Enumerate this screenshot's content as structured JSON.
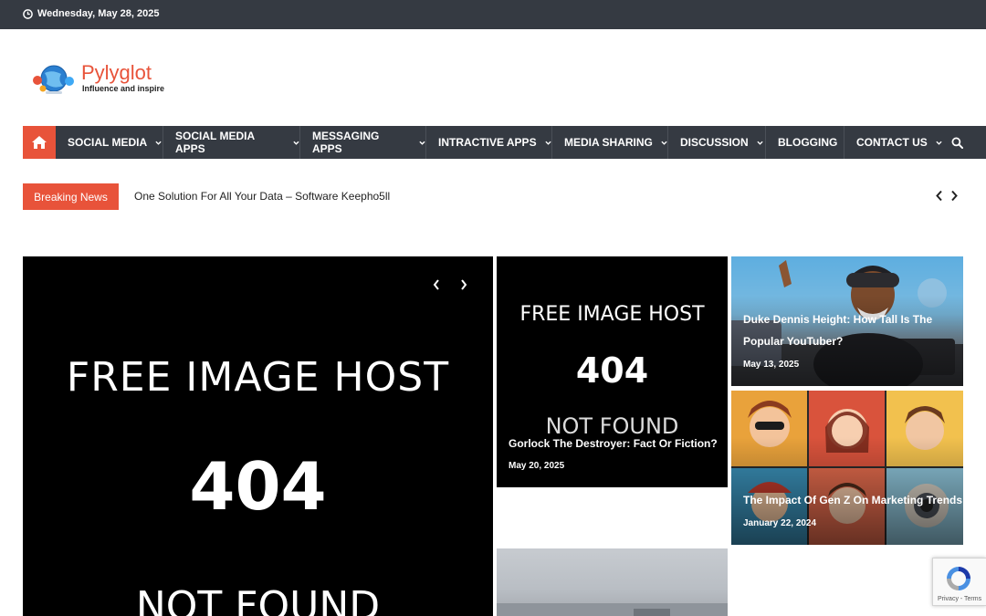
{
  "topbar": {
    "date": "Wednesday, May 28, 2025",
    "icon": "clock-icon"
  },
  "header": {
    "site_title": "Pylyglot",
    "tagline": "Influence and inspire"
  },
  "nav": {
    "home_icon": "home-icon",
    "items": [
      {
        "label": "SOCIAL MEDIA",
        "has_dropdown": true
      },
      {
        "label": "SOCIAL MEDIA APPS",
        "has_dropdown": true
      },
      {
        "label": "MESSAGING APPS",
        "has_dropdown": true
      },
      {
        "label": "INTRACTIVE APPS",
        "has_dropdown": true
      },
      {
        "label": "MEDIA SHARING",
        "has_dropdown": true
      },
      {
        "label": "DISCUSSION",
        "has_dropdown": true
      },
      {
        "label": "BLOGGING",
        "has_dropdown": false
      },
      {
        "label": "CONTACT US",
        "has_dropdown": true
      }
    ],
    "search_icon": "search-icon"
  },
  "breaking": {
    "label": "Breaking News",
    "headline": "One Solution For All Your Data – Software Keepho5ll"
  },
  "placeholder": {
    "line1": "FREE IMAGE HOST",
    "line2": "404",
    "line3": "NOT FOUND"
  },
  "cards": [
    {
      "title": "Gorlock The Destroyer: Fact Or Fiction?",
      "date": "May 20, 2025"
    },
    {
      "title_line1": "Duke Dennis Height: How Tall Is The",
      "title_line2": "Popular YouTuber?",
      "date": "May 13, 2025"
    },
    {
      "title": "The Impact Of Gen Z On Marketing Trends",
      "date": "January 22, 2024"
    }
  ],
  "recaptcha": {
    "text": "Privacy - Terms"
  },
  "colors": {
    "accent": "#e8533a",
    "dark": "#353a42"
  }
}
